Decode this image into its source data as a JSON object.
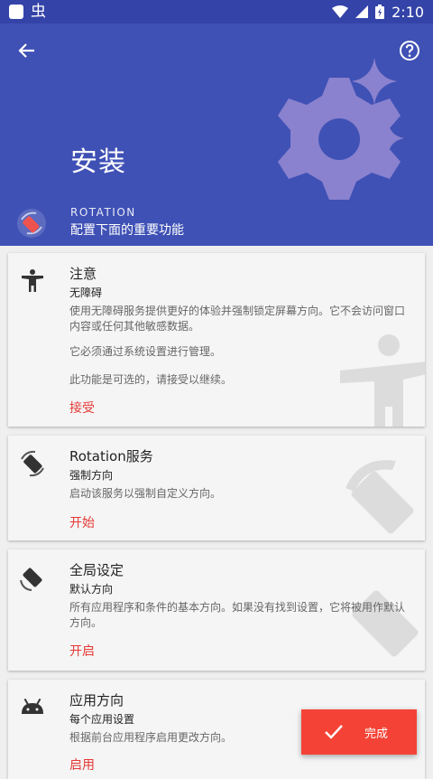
{
  "status_bar": {
    "left_glyph": "虫",
    "time": "2:10",
    "icons": [
      "notification-icon",
      "bug-icon",
      "wifi-icon",
      "signal-icon",
      "battery-icon"
    ]
  },
  "header": {
    "title": "安装",
    "app_name": "ROTATION",
    "app_subtitle": "配置下面的重要功能",
    "icons": [
      "back-arrow-icon",
      "help-icon",
      "settings-gear-icon",
      "sparkle-icon",
      "rotation-app-icon"
    ],
    "background_color": "#3f51b5"
  },
  "cards": [
    {
      "title": "注意",
      "subtitle": "无障碍",
      "description_1": "使用无障碍服务提供更好的体验并强制锁定屏幕方向。它不会访问窗口内容或任何其他敏感数据。",
      "description_2": "它必须通过系统设置进行管理。",
      "description_3": "此功能是可选的，请接受以继续。",
      "action": "接受",
      "icon": "accessibility-icon"
    },
    {
      "title": "Rotation服务",
      "subtitle": "强制方向",
      "description_1": "启动该服务以强制自定义方向。",
      "action": "开始",
      "icon": "rotation-service-icon"
    },
    {
      "title": "全局设定",
      "subtitle": "默认方向",
      "description_1": "所有应用程序和条件的基本方向。如果没有找到设置，它将被用作默认方向。",
      "action": "开启",
      "icon": "global-orientation-icon"
    },
    {
      "title": "应用方向",
      "subtitle": "每个应用设置",
      "description_1": "根据前台应用程序启用更改方向。",
      "action": "启用",
      "icon": "android-icon"
    }
  ],
  "fab": {
    "label": "完成",
    "icon": "check-icon"
  },
  "colors": {
    "accent": "#f44336",
    "action_text": "#e53935",
    "header": "#3f51b5",
    "status_bar": "#3443a8"
  }
}
